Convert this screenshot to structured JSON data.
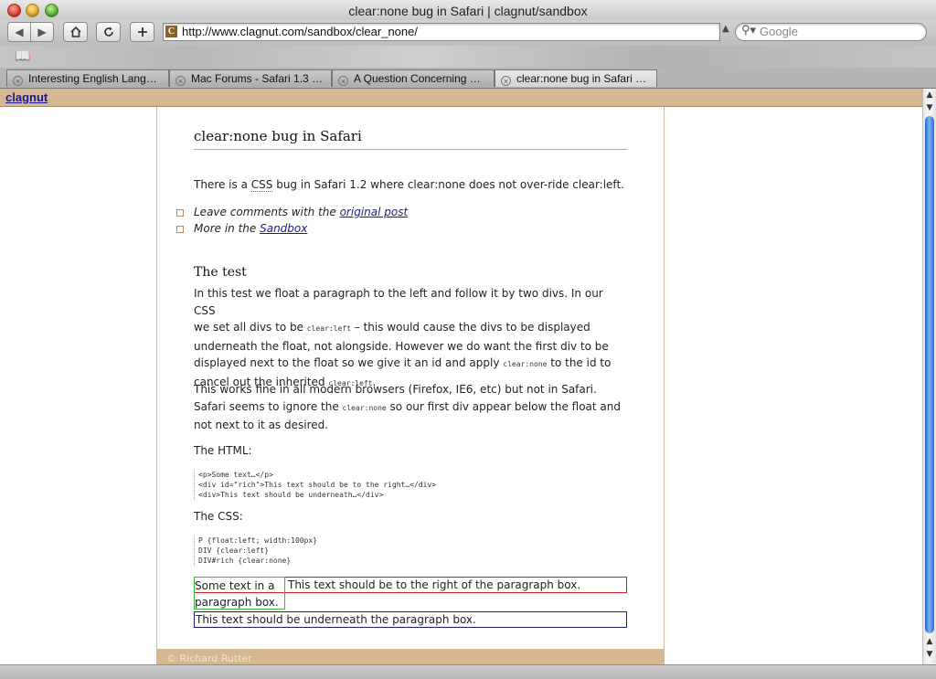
{
  "window": {
    "title": "clear:none bug in Safari | clagnut/sandbox"
  },
  "toolbar": {
    "url": "http://www.clagnut.com/sandbox/clear_none/",
    "search_placeholder": "Google"
  },
  "tabs": [
    {
      "label": "Interesting English Lang…"
    },
    {
      "label": "Mac Forums - Safari 1.3 …"
    },
    {
      "label": "A Question Concerning …"
    },
    {
      "label": "clear:none bug in Safari …"
    }
  ],
  "site": {
    "name": "clagnut",
    "footer": "© Richard Rutter"
  },
  "article": {
    "title": "clear:none bug in Safari",
    "intro_1": "There is a ",
    "intro_abbr": "CSS",
    "intro_2": " bug in Safari 1.2 where clear:none does not over-ride clear:left.",
    "list": [
      {
        "text": "Leave comments with the ",
        "link": "original post"
      },
      {
        "text": "More in the ",
        "link": "Sandbox"
      }
    ],
    "test_heading": "The test",
    "test_p1_a": "In this test we float a paragraph to the left and follow it by two divs. In our CSS",
    "test_p1_b": "we set all divs to be ",
    "code_clear_left": "clear:left",
    "test_p1_c": " – this would cause the divs to be displayed",
    "test_p1_d": "underneath the float, not alongside. However we do want the first div to be",
    "test_p1_e": "displayed next to the float so we give it an id and apply ",
    "code_clear_none": "clear:none",
    "test_p1_f": " to the id to",
    "test_p1_g": "cancel out the inherited ",
    "test_p1_h": ".",
    "test_p2_a": "This works fine in all modern browsers (Firefox, IE6, etc) but not in Safari.",
    "test_p2_b": "Safari seems to ignore the ",
    "test_p2_c": " so our first div appear below the float and",
    "test_p2_d": "not next to it as desired.",
    "html_label": "The HTML:",
    "html_code": [
      "<p>Some text…</p>",
      "<div id=\"rich\">This text should be to the right…</div>",
      "<div>This text should be underneath…</div>"
    ],
    "css_label": "The CSS:",
    "css_code": [
      "P {float:left; width:100px}",
      "DIV {clear:left}",
      "DIV#rich {clear:none}"
    ],
    "demo_para": "Some text in a paragraph box.",
    "demo_rich": "This text should be to the right of the paragraph box.",
    "demo_div": "This text should be underneath the paragraph box."
  }
}
